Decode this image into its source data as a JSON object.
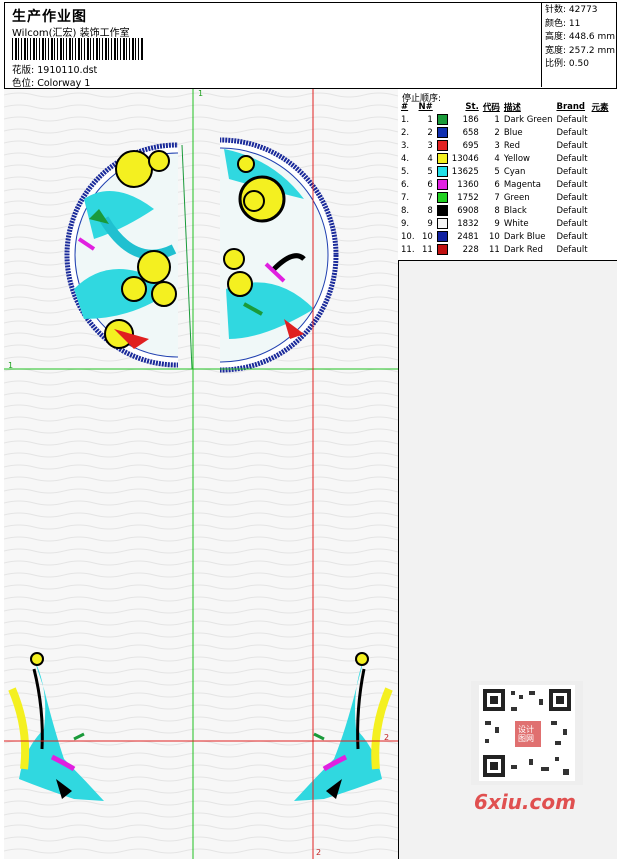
{
  "header": {
    "title": "生产作业图",
    "studio": "Wilcom(汇宏) 装饰工作室",
    "design_label": "花版:",
    "design_value": "1910110.dst",
    "colorway_label": "色位:",
    "colorway_value": "Colorway 1"
  },
  "stats": {
    "stitches": "针数: 42773",
    "colors": "颜色: 11",
    "height": "高度: 448.6 mm",
    "width": "宽度: 257.2 mm",
    "scale": "比例: 0.50"
  },
  "sequence": {
    "title": "停止顺序:",
    "columns": [
      "#",
      "N#",
      "",
      "St.",
      "代码",
      "描述",
      "Brand",
      "元素"
    ],
    "rows": [
      {
        "idx": "1.",
        "n": "1",
        "color": "#1a9a3a",
        "st": "186",
        "code": "1",
        "desc": "Dark Green",
        "brand": "Default"
      },
      {
        "idx": "2.",
        "n": "2",
        "color": "#1030b0",
        "st": "658",
        "code": "2",
        "desc": "Blue",
        "brand": "Default"
      },
      {
        "idx": "3.",
        "n": "3",
        "color": "#e02020",
        "st": "695",
        "code": "3",
        "desc": "Red",
        "brand": "Default"
      },
      {
        "idx": "4.",
        "n": "4",
        "color": "#f4f020",
        "st": "13046",
        "code": "4",
        "desc": "Yellow",
        "brand": "Default"
      },
      {
        "idx": "5.",
        "n": "5",
        "color": "#20e0e8",
        "st": "13625",
        "code": "5",
        "desc": "Cyan",
        "brand": "Default"
      },
      {
        "idx": "6.",
        "n": "6",
        "color": "#e020e0",
        "st": "1360",
        "code": "6",
        "desc": "Magenta",
        "brand": "Default"
      },
      {
        "idx": "7.",
        "n": "7",
        "color": "#20d020",
        "st": "1752",
        "code": "7",
        "desc": "Green",
        "brand": "Default"
      },
      {
        "idx": "8.",
        "n": "8",
        "color": "#000000",
        "st": "6908",
        "code": "8",
        "desc": "Black",
        "brand": "Default"
      },
      {
        "idx": "9.",
        "n": "9",
        "color": "#f4f4f4",
        "st": "1832",
        "code": "9",
        "desc": "White",
        "brand": "Default"
      },
      {
        "idx": "10.",
        "n": "10",
        "color": "#1020a0",
        "st": "2481",
        "code": "10",
        "desc": "Dark Blue",
        "brand": "Default"
      },
      {
        "idx": "11.",
        "n": "11",
        "color": "#c01010",
        "st": "228",
        "code": "11",
        "desc": "Dark Red",
        "brand": "Default"
      }
    ]
  },
  "canvas": {
    "marker_top": "1",
    "marker_left": "1",
    "marker_right_mid": "2",
    "marker_bottom": "2"
  },
  "watermark": "6xiu.com",
  "qr_caption": "设计 图网"
}
